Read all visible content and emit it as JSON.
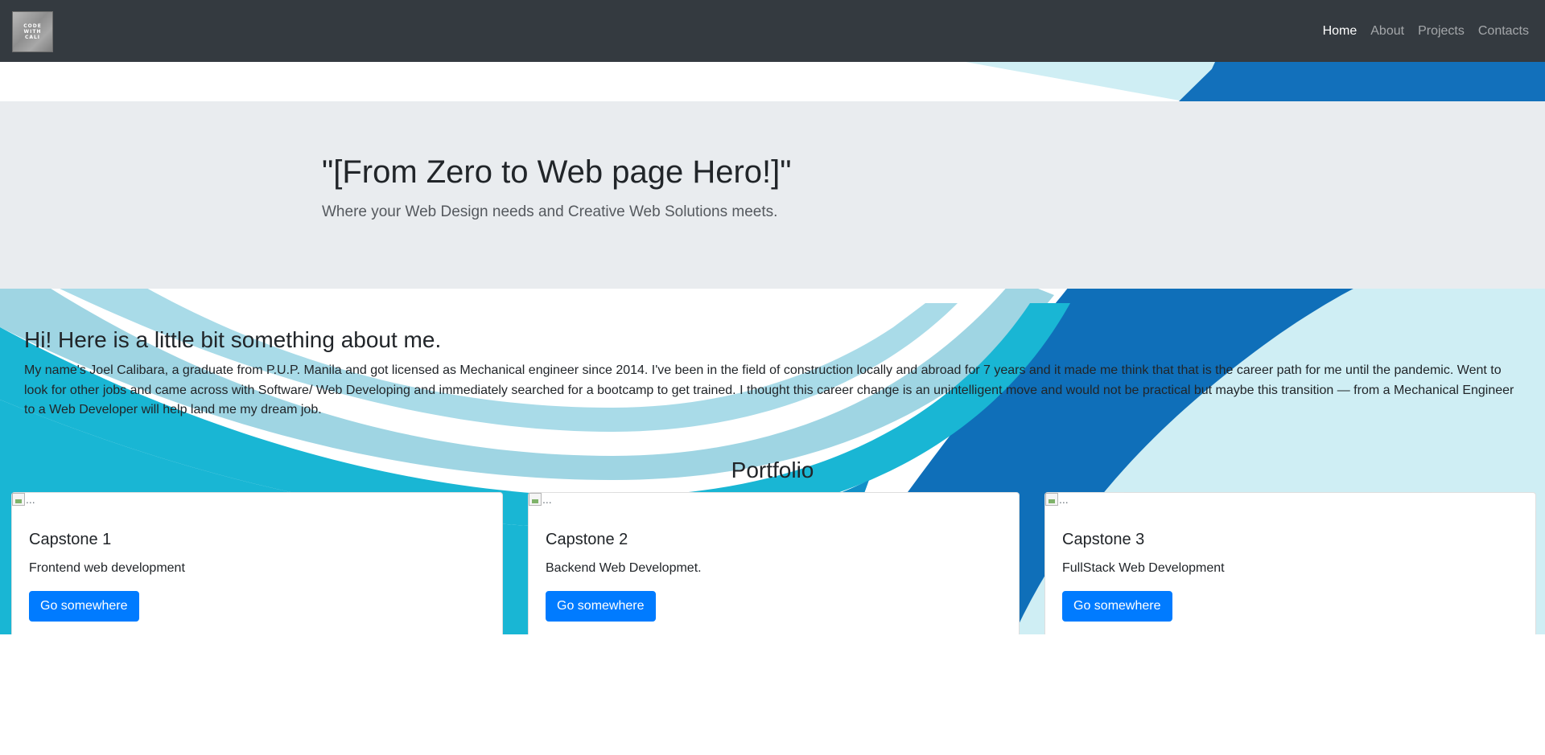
{
  "navbar": {
    "logo_lines": [
      "CODE",
      "WITH",
      "CALI"
    ],
    "links": [
      {
        "label": "Home",
        "active": true
      },
      {
        "label": "About",
        "active": false
      },
      {
        "label": "Projects",
        "active": false
      },
      {
        "label": "Contacts",
        "active": false
      }
    ]
  },
  "jumbotron": {
    "title": "\"[From Zero to Web page Hero!]\"",
    "lead": "Where your Web Design needs and Creative Web Solutions meets."
  },
  "about": {
    "heading": "Hi! Here is a little bit something about me.",
    "text": "My name's Joel Calibara, a graduate from P.U.P. Manila and got licensed as Mechanical engineer since 2014. I've been in the field of construction locally and abroad for 7 years and it made me think that that is the career path for me until the pandemic. Went to look for other jobs and came across with Software/ Web Developing and immediately searched for a bootcamp to get trained. I thought this career change is an unintelligent move and would not be practical but maybe this transition — from a Mechanical Engineer to a Web Developer will help land me my dream job."
  },
  "portfolio": {
    "heading": "Portfolio",
    "cards": [
      {
        "img_alt": "...",
        "title": "Capstone 1",
        "text": "Frontend web development",
        "button": "Go somewhere"
      },
      {
        "img_alt": "...",
        "title": "Capstone 2",
        "text": "Backend Web Developmet.",
        "button": "Go somewhere"
      },
      {
        "img_alt": "...",
        "title": "Capstone 3",
        "text": "FullStack Web Development",
        "button": "Go somewhere"
      }
    ]
  },
  "colors": {
    "navbar_bg": "#343a40",
    "jumbotron_bg": "#e9ecef",
    "primary_button": "#007bff",
    "wave_dark_blue": "#0f6fb9",
    "wave_cyan": "#19b6d4",
    "wave_light": "#cfeef4"
  }
}
